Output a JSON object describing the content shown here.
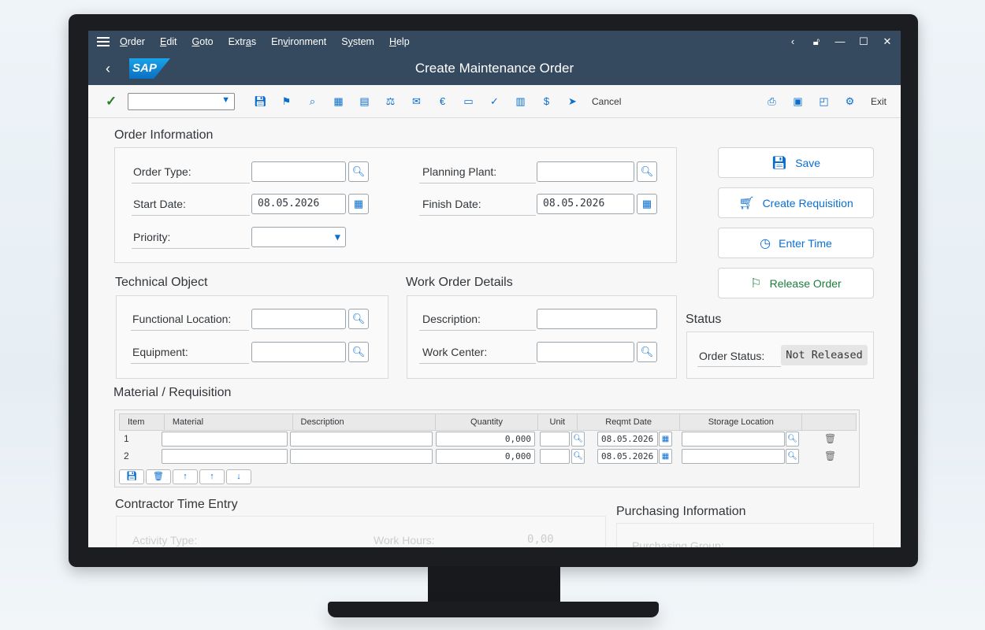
{
  "menubar": {
    "items": [
      "Order",
      "Edit",
      "Goto",
      "Extras",
      "Environment",
      "System",
      "Help"
    ],
    "underline_index": [
      0,
      0,
      0,
      4,
      2,
      1,
      0
    ]
  },
  "titlebar": {
    "logo_text": "SAP",
    "title": "Create Maintenance Order"
  },
  "toolbar": {
    "cancel_label": "Cancel",
    "exit_label": "Exit"
  },
  "order_information": {
    "title": "Order Information",
    "order_type_label": "Order Type:",
    "order_type_value": "",
    "planning_plant_label": "Planning Plant:",
    "planning_plant_value": "",
    "start_date_label": "Start Date:",
    "start_date_value": "08.05.2026",
    "finish_date_label": "Finish Date:",
    "finish_date_value": "08.05.2026",
    "priority_label": "Priority:",
    "priority_value": ""
  },
  "actions": {
    "save": "Save",
    "create_requisition": "Create Requisition",
    "enter_time": "Enter Time",
    "release_order": "Release Order"
  },
  "technical_object": {
    "title": "Technical Object",
    "functional_location_label": "Functional Location:",
    "equipment_label": "Equipment:"
  },
  "work_order_details": {
    "title": "Work Order Details",
    "description_label": "Description:",
    "work_center_label": "Work Center:"
  },
  "status": {
    "title": "Status",
    "order_status_label": "Order Status:",
    "order_status_value": "Not Released"
  },
  "material": {
    "title": "Material / Requisition",
    "columns": [
      "Item",
      "Material",
      "Description",
      "Quantity",
      "Unit",
      "Reqmt Date",
      "Storage Location"
    ],
    "rows": [
      {
        "item": "1",
        "material": "",
        "description": "",
        "quantity": "0,000",
        "unit": "",
        "reqmt_date": "08.05.2026",
        "storage_location": ""
      },
      {
        "item": "2",
        "material": "",
        "description": "",
        "quantity": "0,000",
        "unit": "",
        "reqmt_date": "08.05.2026",
        "storage_location": ""
      }
    ]
  },
  "contractor": {
    "title": "Contractor Time Entry",
    "activity_type_label": "Activity Type:",
    "work_hours_label": "Work Hours:",
    "work_hours_value": "0,00"
  },
  "purchasing": {
    "title": "Purchasing Information",
    "purchasing_group_label": "Purchasing Group:"
  }
}
